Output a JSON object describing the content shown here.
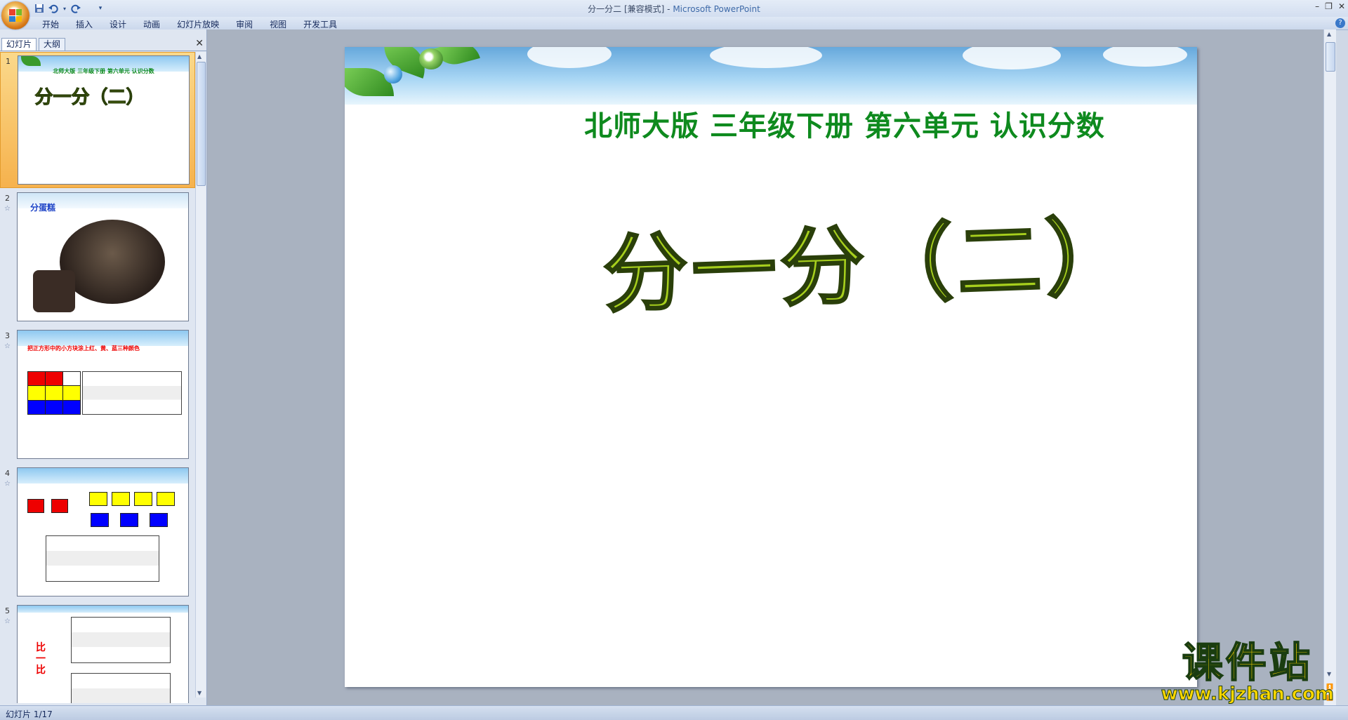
{
  "window": {
    "doc_title": "分一分二 [兼容模式]",
    "separator": " - ",
    "app_name": "Microsoft PowerPoint"
  },
  "quick_access": {
    "save": "save-icon",
    "undo": "undo-icon",
    "redo": "redo-icon",
    "customize": "▾"
  },
  "menu": [
    "开始",
    "插入",
    "设计",
    "动画",
    "幻灯片放映",
    "审阅",
    "视图",
    "开发工具"
  ],
  "pane_tabs": {
    "slides": "幻灯片",
    "outline": "大纲"
  },
  "thumbnails": [
    {
      "number": "1",
      "subtitle": "北师大版  三年级下册  第六单元  认识分数",
      "title": "分一分（二）"
    },
    {
      "number": "2",
      "label": "分蛋糕"
    },
    {
      "number": "3",
      "title": "把正方形中的小方块涂上红、黄、蓝三种颜色"
    },
    {
      "number": "4"
    },
    {
      "number": "5",
      "side_text": "比一比"
    }
  ],
  "slide": {
    "subtitle": "北师大版  三年级下册  第六单元  认识分数",
    "title": "分一分（二）"
  },
  "status": {
    "slide_info": "幻灯片 1/17"
  },
  "watermark": {
    "name": "课件站",
    "url": "www.kjzhan.com"
  },
  "colors": {
    "accent_green": "#0e8a1e",
    "title_green": "#a7cf1d",
    "watermark_yellow": "#ffd700"
  }
}
